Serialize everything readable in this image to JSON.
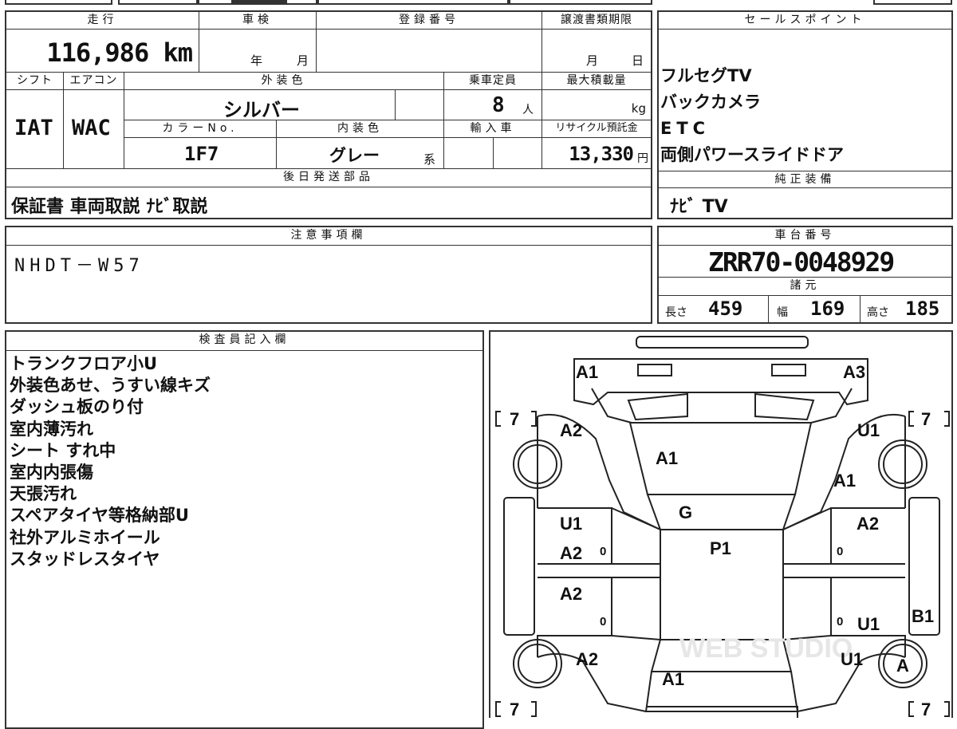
{
  "top": {
    "mileage_label": "走行",
    "mileage_value": "116,986",
    "mileage_unit": "km",
    "shaken_label": "車検",
    "shaken_year": "年",
    "shaken_month": "月",
    "reg_label": "登録番号",
    "reg_value": "",
    "transfer_label": "譲渡書類期限",
    "transfer_month": "月",
    "transfer_day": "日",
    "shift_label": "シフト",
    "shift_value": "IAT",
    "ac_label": "エアコン",
    "ac_value": "WAC",
    "ext_color_label": "外装色",
    "ext_color_value": "シルバー",
    "capacity_label": "乗車定員",
    "capacity_value": "8",
    "capacity_unit": "人",
    "max_load_label": "最大積載量",
    "max_load_unit": "kg",
    "color_no_label": "カラーNo.",
    "color_no_value": "1F7",
    "int_color_label": "内装色",
    "int_color_value": "グレー",
    "int_color_suffix": "系",
    "import_label": "輸入車",
    "recycle_label": "リサイクル預託金",
    "recycle_value": "13,330",
    "recycle_unit": "円",
    "later_label": "後日発送部品",
    "later_value": "保証書 車両取説 ﾅﾋﾞ取説"
  },
  "sales": {
    "label": "セールスポイント",
    "items": [
      "フルセグTV",
      "バックカメラ",
      "ETC",
      "両側パワースライドドア"
    ],
    "genuine_label": "純正装備",
    "genuine_value": "ﾅﾋﾞ TV"
  },
  "notes": {
    "label": "注意事項欄",
    "value": "NHDT－W57"
  },
  "chassis": {
    "label": "車台番号",
    "value": "ZRR70-0048929",
    "spec_label": "諸元",
    "length_label": "長さ",
    "length_value": "459",
    "width_label": "幅",
    "width_value": "169",
    "height_label": "高さ",
    "height_value": "185"
  },
  "inspector": {
    "label": "検査員記入欄",
    "lines": [
      "トランクフロア小U",
      "外装色あせ、うすい線キズ",
      "ダッシュ板のり付",
      "室内薄汚れ",
      "シート すれ中",
      "室内内張傷",
      "天張汚れ",
      "スペアタイヤ等格納部U",
      "社外アルミホイール",
      "スタッドレスタイヤ"
    ]
  },
  "diagram": {
    "marks": {
      "front_left": "A1",
      "front_right": "A3",
      "fl_fender": "A2",
      "fr_fender": "U1",
      "hood": "A1",
      "right_pillar": "A1",
      "windshield": "G",
      "roof": "P1",
      "left_door_u": "U1",
      "left_door_a2": "A2",
      "left_rear_door": "A2",
      "right_door": "A2",
      "right_rear_door_u": "U1",
      "right_side_rear": "B1",
      "rear_left": "A2",
      "rear_right": "U1",
      "rear_center": "A1",
      "rear_tire": "A",
      "tire_fl": "7",
      "tire_fr": "7",
      "tire_rl": "7",
      "tire_rr": "7",
      "zero": "0"
    },
    "watermark": "WEB STUDIO"
  }
}
